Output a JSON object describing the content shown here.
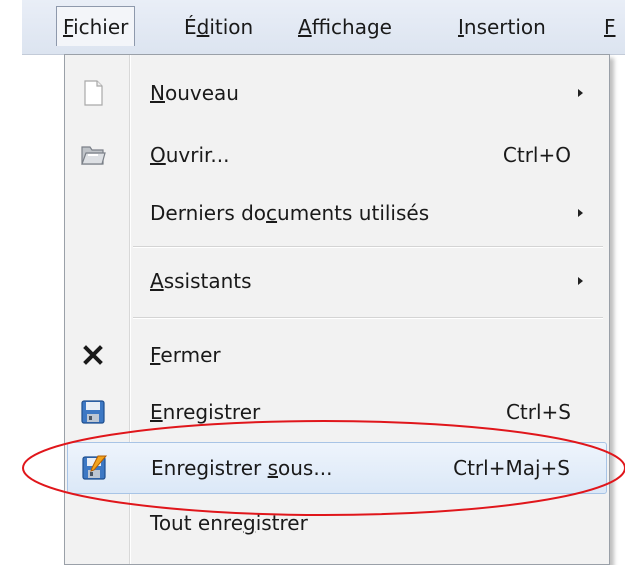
{
  "menubar": {
    "items": [
      {
        "pre": "",
        "ul": "F",
        "post": "ichier"
      },
      {
        "pre": "É",
        "ul": "d",
        "post": "ition"
      },
      {
        "pre": "",
        "ul": "A",
        "post": "ffichage"
      },
      {
        "pre": "",
        "ul": "I",
        "post": "nsertion"
      },
      {
        "pre": "",
        "ul": "F",
        "post": ""
      }
    ]
  },
  "menu": {
    "items": [
      {
        "pre": "",
        "ul": "N",
        "post": "ouveau",
        "shortcut": "",
        "submenu": true,
        "icon": "new-document-icon"
      },
      {
        "pre": "",
        "ul": "O",
        "post": "uvrir...",
        "shortcut": "Ctrl+O",
        "submenu": false,
        "icon": "open-folder-icon"
      },
      {
        "pre": "Derniers do",
        "ul": "c",
        "post": "uments utilisés",
        "shortcut": "",
        "submenu": true,
        "icon": ""
      },
      {
        "pre": "",
        "ul": "A",
        "post": "ssistants",
        "shortcut": "",
        "submenu": true,
        "icon": ""
      },
      {
        "pre": "",
        "ul": "F",
        "post": "ermer",
        "shortcut": "",
        "submenu": false,
        "icon": "close-icon"
      },
      {
        "pre": "",
        "ul": "E",
        "post": "nregistrer",
        "shortcut": "Ctrl+S",
        "submenu": false,
        "icon": "save-icon"
      },
      {
        "pre": "Enregistrer ",
        "ul": "s",
        "post": "ous...",
        "shortcut": "Ctrl+Maj+S",
        "submenu": false,
        "icon": "save-as-icon"
      },
      {
        "pre": "Tout enre",
        "ul": "g",
        "post": "istrer",
        "shortcut": "",
        "submenu": false,
        "icon": ""
      }
    ]
  },
  "colors": {
    "annotation": "#e0161b",
    "highlight_border": "#a8c4e6",
    "menu_bg": "#f2f2f2"
  }
}
